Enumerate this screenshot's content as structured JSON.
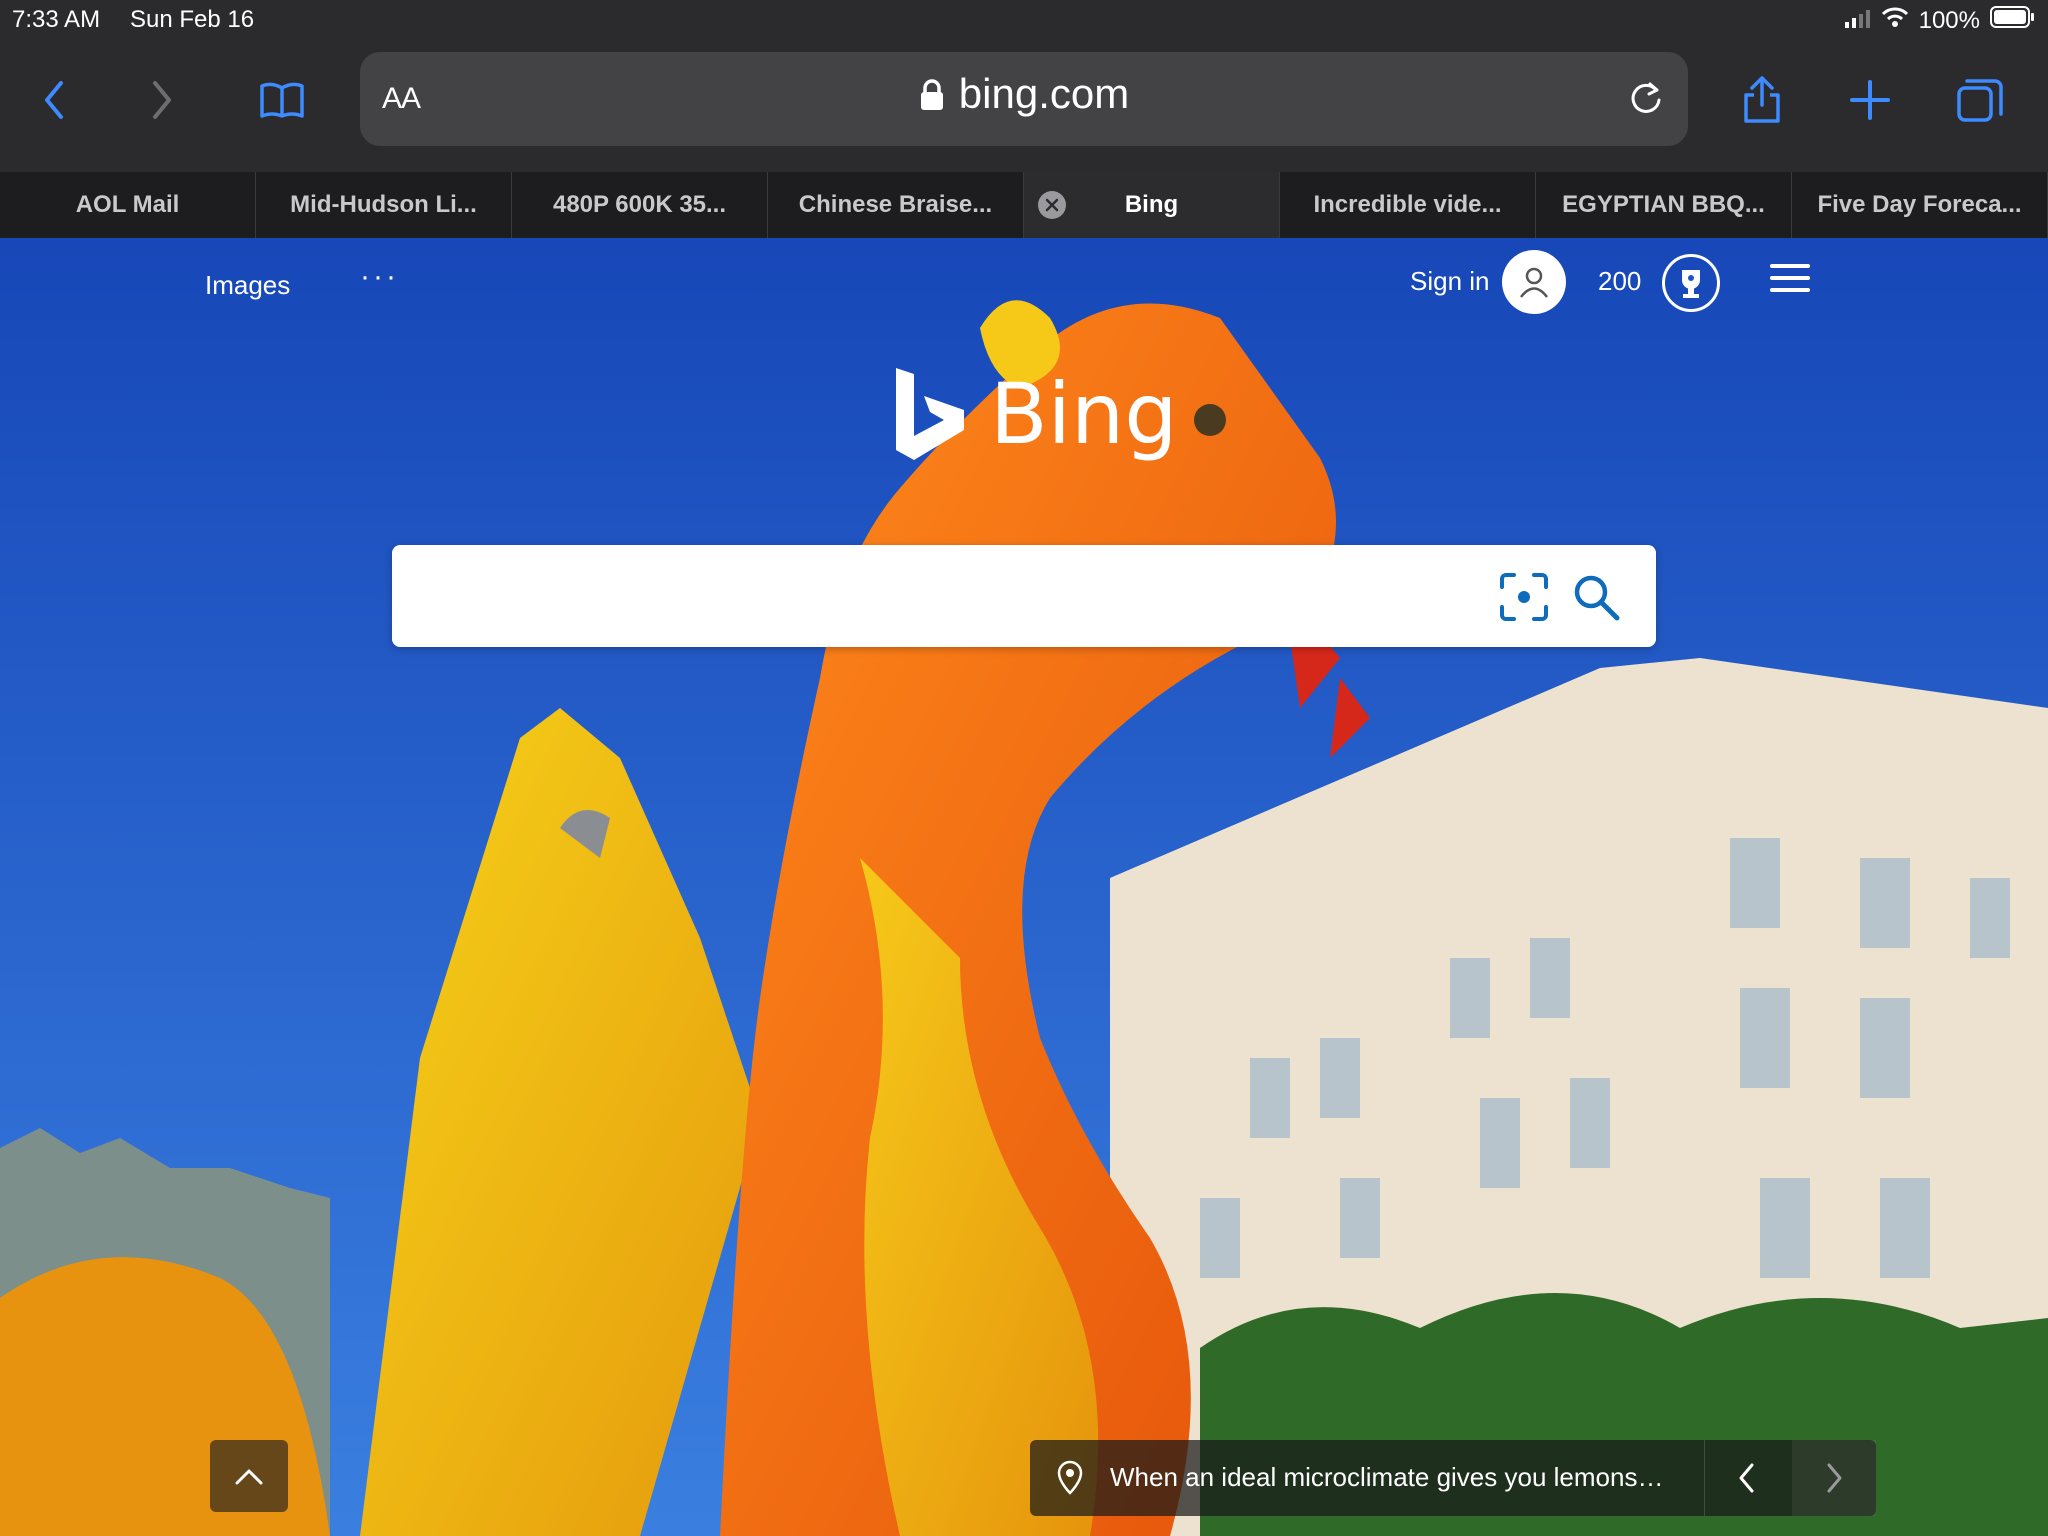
{
  "status_bar": {
    "time": "7:33 AM",
    "date": "Sun Feb 16",
    "battery": "100%"
  },
  "browser": {
    "text_size_label": "AA",
    "url": "bing.com",
    "accent_color": "#3d8bff",
    "tabs": [
      {
        "title": "AOL Mail",
        "active": false
      },
      {
        "title": "Mid-Hudson Li...",
        "active": false
      },
      {
        "title": "480P 600K 35...",
        "active": false
      },
      {
        "title": "Chinese Braise...",
        "active": false
      },
      {
        "title": "Bing",
        "active": true
      },
      {
        "title": "Incredible vide...",
        "active": false
      },
      {
        "title": "EGYPTIAN BBQ...",
        "active": false
      },
      {
        "title": "Five Day Foreca...",
        "active": false
      }
    ]
  },
  "page": {
    "nav": {
      "images": "Images",
      "more": "···"
    },
    "header": {
      "sign_in": "Sign in",
      "points": "200"
    },
    "logo_text": "Bing",
    "search": {
      "value": "",
      "placeholder": ""
    },
    "caption": "When an ideal microclimate gives you lemons…"
  }
}
